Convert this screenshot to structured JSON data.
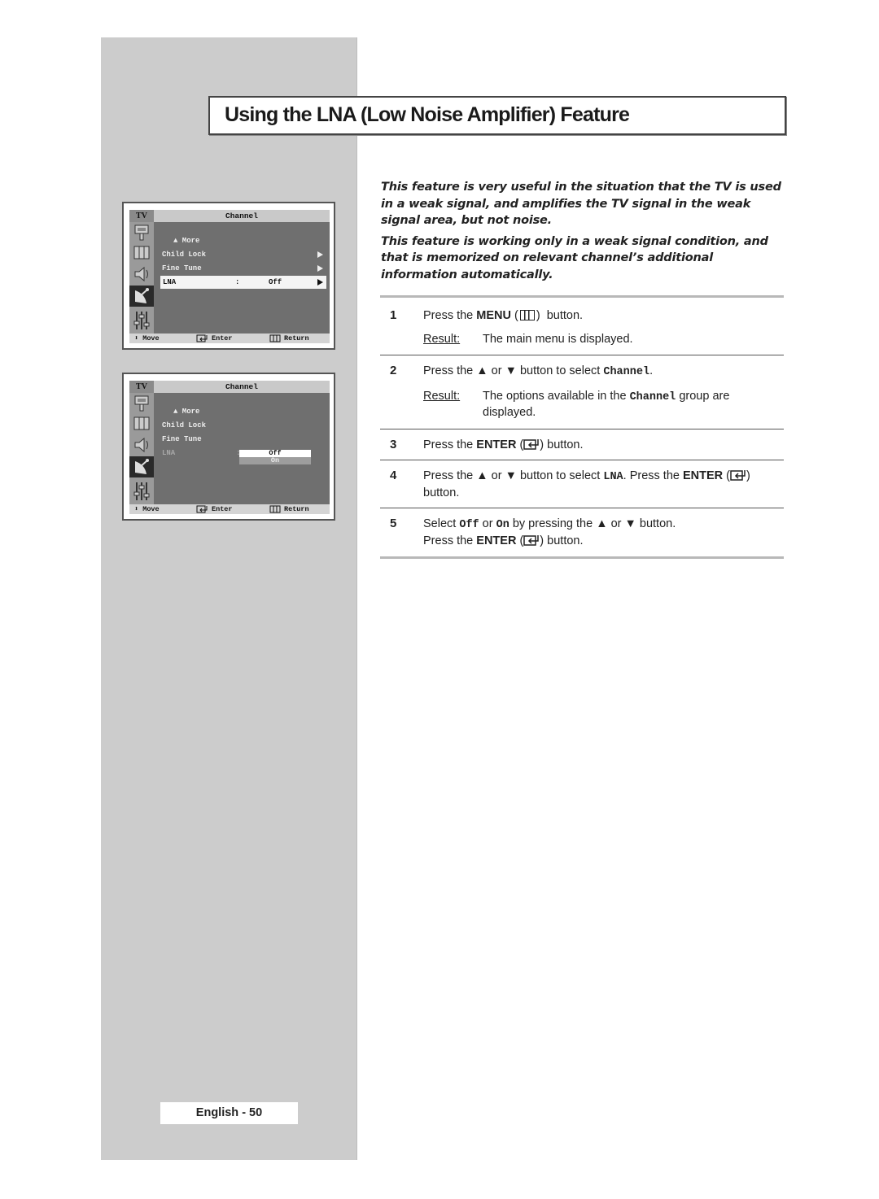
{
  "page": {
    "title": "Using the LNA (Low Noise Amplifier) Feature",
    "footer": "English - 50"
  },
  "intro": [
    "This feature is very useful in the situation that the TV is used in a weak signal, and amplifies the TV signal in the weak signal area, but not noise.",
    "This feature is working only in a weak signal condition, and that is memorized on relevant channel’s additional information automatically."
  ],
  "steps": [
    {
      "num": "1",
      "pre": "Press the ",
      "key": "MENU",
      "post": " button.",
      "result_label": "Result:",
      "result": "The main menu is displayed."
    },
    {
      "num": "2",
      "pre": "Press the ▲ or ▼ button to select ",
      "code": "Channel",
      "post": ".",
      "result_label": "Result:",
      "result_pre": "The options available in the ",
      "result_code": "Channel",
      "result_post": " group are displayed."
    },
    {
      "num": "3",
      "pre": "Press the ",
      "key": "ENTER",
      "post": " button."
    },
    {
      "num": "4",
      "pre": "Press the ▲ or ▼ button to select ",
      "code": "LNA",
      "mid": ". Press the ",
      "key": "ENTER",
      "post": " button."
    },
    {
      "num": "5",
      "pre": "Select ",
      "code1": "Off",
      "mid": " or ",
      "code2": "On",
      "post": "  by pressing the ▲ or ▼ button.",
      "line2_pre": "Press the ",
      "key": "ENTER",
      "line2_post": " button."
    }
  ],
  "osd": {
    "tab": "TV",
    "header": "Channel",
    "items": {
      "more": "▲ More",
      "child_lock": "Child Lock",
      "fine_tune": "Fine Tune",
      "lna": "LNA"
    },
    "colon": ":",
    "lna_value": "Off",
    "options": [
      "Off",
      "On"
    ],
    "footer": {
      "move": "⬍ Move",
      "enter": "Enter",
      "return": "Return"
    }
  }
}
